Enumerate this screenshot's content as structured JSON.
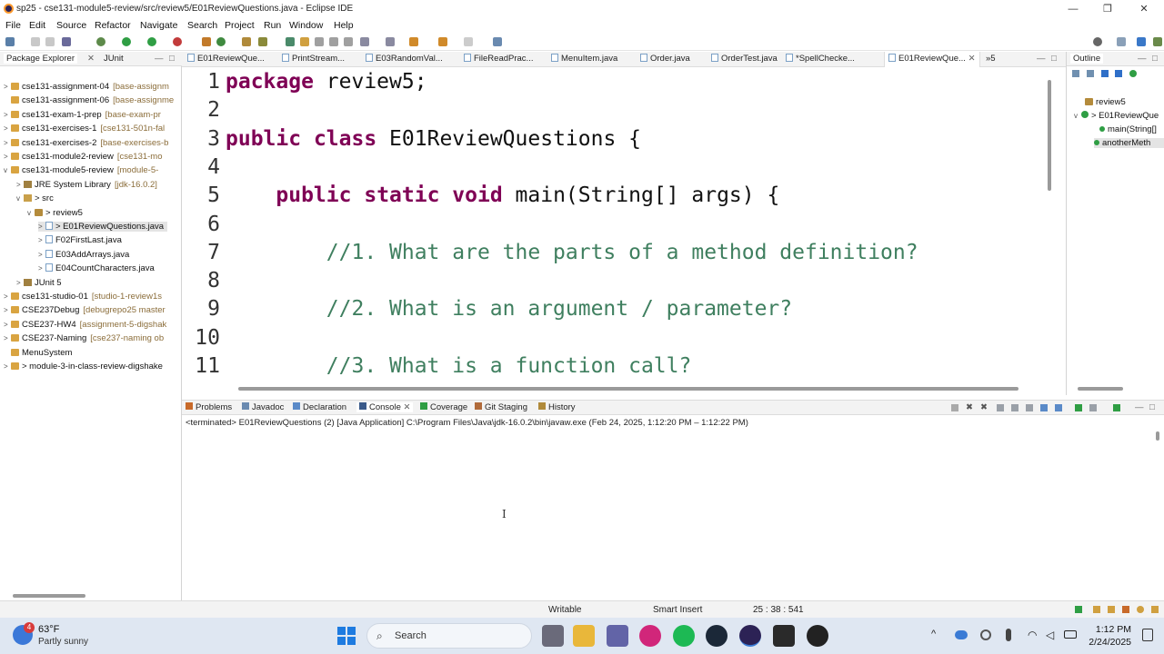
{
  "window": {
    "title": "sp25 - cse131-module5-review/src/review5/E01ReviewQuestions.java - Eclipse IDE",
    "minimize": "—",
    "maximize": "❐",
    "close": "✕"
  },
  "menu": [
    "File",
    "Edit",
    "Source",
    "Refactor",
    "Navigate",
    "Search",
    "Project",
    "Run",
    "Window",
    "Help"
  ],
  "left_panel": {
    "tabs": [
      "Package Explorer",
      "JUnit"
    ],
    "tree": [
      {
        "twisty": ">",
        "label": "cse131-assignment-04",
        "decoration": "[base-assignm"
      },
      {
        "twisty": "",
        "label": "cse131-assignment-06",
        "decoration": "[base-assignme"
      },
      {
        "twisty": ">",
        "label": "cse131-exam-1-prep",
        "decoration": "[base-exam-pr"
      },
      {
        "twisty": ">",
        "label": "cse131-exercises-1",
        "decoration": "[cse131-501n-fal"
      },
      {
        "twisty": ">",
        "label": "cse131-exercises-2",
        "decoration": "[base-exercises-b"
      },
      {
        "twisty": ">",
        "label": "cse131-module2-review",
        "decoration": "[cse131-mo"
      },
      {
        "twisty": "v",
        "label": "cse131-module5-review",
        "decoration": "[module-5-"
      },
      {
        "twisty": ">",
        "label": "JRE System Library",
        "decoration": "[jdk-16.0.2]"
      },
      {
        "twisty": "v",
        "label": "> src",
        "decoration": ""
      },
      {
        "twisty": "v",
        "label": "> review5",
        "decoration": ""
      },
      {
        "twisty": ">",
        "label": "> E01ReviewQuestions.java",
        "decoration": ""
      },
      {
        "twisty": ">",
        "label": "F02FirstLast.java",
        "decoration": ""
      },
      {
        "twisty": ">",
        "label": "E03AddArrays.java",
        "decoration": ""
      },
      {
        "twisty": ">",
        "label": "E04CountCharacters.java",
        "decoration": ""
      },
      {
        "twisty": ">",
        "label": "JUnit 5",
        "decoration": ""
      },
      {
        "twisty": ">",
        "label": "cse131-studio-01",
        "decoration": "[studio-1-review1s"
      },
      {
        "twisty": ">",
        "label": "CSE237Debug",
        "decoration": "[debugrepo25 master"
      },
      {
        "twisty": ">",
        "label": "CSE237-HW4",
        "decoration": "[assignment-5-digshak"
      },
      {
        "twisty": ">",
        "label": "CSE237-Naming",
        "decoration": "[cse237-naming ob"
      },
      {
        "twisty": "",
        "label": "MenuSystem",
        "decoration": ""
      },
      {
        "twisty": ">",
        "label": "> module-3-in-class-review-digshake",
        "decoration": ""
      }
    ]
  },
  "editor": {
    "tabs": [
      "E01ReviewQue...",
      "PrintStream...",
      "E03RandomVal...",
      "FileReadPrac...",
      "MenuItem.java",
      "Order.java",
      "OrderTest.java",
      "*SpellChecke...",
      "E01ReviewQue..."
    ],
    "overflow": "»5",
    "lines": [
      {
        "n": "1",
        "parts": [
          {
            "t": "package",
            "c": "kw"
          },
          {
            "t": " review5;",
            "c": ""
          }
        ]
      },
      {
        "n": "2",
        "parts": []
      },
      {
        "n": "3",
        "parts": [
          {
            "t": "public",
            "c": "kw"
          },
          {
            "t": " ",
            "c": ""
          },
          {
            "t": "class",
            "c": "kw"
          },
          {
            "t": " E01ReviewQuestions {",
            "c": ""
          }
        ]
      },
      {
        "n": "4",
        "parts": []
      },
      {
        "n": "5",
        "parts": [
          {
            "t": "    ",
            "c": ""
          },
          {
            "t": "public",
            "c": "kw"
          },
          {
            "t": " ",
            "c": ""
          },
          {
            "t": "static",
            "c": "kw"
          },
          {
            "t": " ",
            "c": ""
          },
          {
            "t": "void",
            "c": "kw"
          },
          {
            "t": " main(String[] args) {",
            "c": ""
          }
        ]
      },
      {
        "n": "6",
        "parts": []
      },
      {
        "n": "7",
        "parts": [
          {
            "t": "        ",
            "c": ""
          },
          {
            "t": "//1. What are the parts of a method definition?",
            "c": "cm"
          }
        ]
      },
      {
        "n": "8",
        "parts": []
      },
      {
        "n": "9",
        "parts": [
          {
            "t": "        ",
            "c": ""
          },
          {
            "t": "//2. What is an argument / parameter?",
            "c": "cm"
          }
        ]
      },
      {
        "n": "10",
        "parts": []
      },
      {
        "n": "11",
        "parts": [
          {
            "t": "        ",
            "c": ""
          },
          {
            "t": "//3. What is a function call?",
            "c": "cm"
          }
        ]
      }
    ]
  },
  "outline": {
    "tab": "Outline",
    "items": [
      "review5",
      "> E01ReviewQue",
      "main(String[]",
      "anotherMeth"
    ]
  },
  "bottom_panel": {
    "tabs": [
      "Problems",
      "Javadoc",
      "Declaration",
      "Console",
      "Coverage",
      "Git Staging",
      "History"
    ],
    "terminated_line": "<terminated> E01ReviewQuestions (2) [Java Application] C:\\Program Files\\Java\\jdk-16.0.2\\bin\\javaw.exe  (Feb 24, 2025, 1:12:20 PM – 1:12:22 PM)"
  },
  "status": {
    "writable": "Writable",
    "insert_mode": "Smart Insert",
    "position": "25 : 38 : 541"
  },
  "taskbar": {
    "weather_temp": "63°F",
    "weather_desc": "Partly sunny",
    "weather_badge": "4",
    "search_placeholder": "Search",
    "time": "1:12 PM",
    "date": "2/24/2025"
  },
  "colors": {
    "keyword": "#7f0055",
    "comment": "#3f7f5f",
    "taskbar": "#dfe7f2"
  }
}
